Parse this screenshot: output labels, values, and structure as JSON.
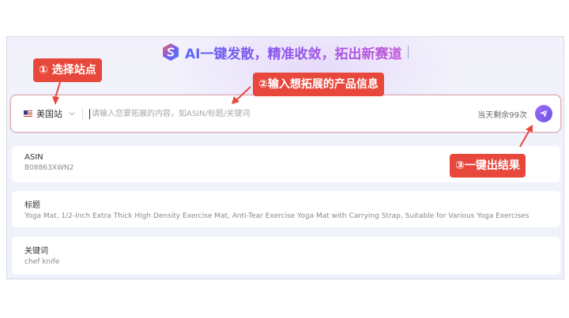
{
  "header": {
    "title": "AI一键发散，精准收敛，拓出新赛道",
    "logo_icon": "brand-s-logo-icon"
  },
  "search": {
    "site_label": "美国站",
    "site_flag_icon": "us-flag-icon",
    "placeholder": "请输入您要拓展的内容，如ASIN/标题/关键词",
    "remaining": "当天剩余99次",
    "submit_icon": "paper-plane-icon"
  },
  "examples": [
    {
      "label": "ASIN",
      "value": "B08863XWN2"
    },
    {
      "label": "标题",
      "value": "Yoga Mat, 1/2-Inch Extra Thick High Density Exercise Mat, Anti-Tear Exercise Yoga Mat with Carrying Strap, Suitable for Various Yoga Exercises"
    },
    {
      "label": "关键词",
      "value": "chef knife"
    }
  ],
  "callouts": [
    {
      "text": "① 选择站点"
    },
    {
      "text": "②输入想拓展的产品信息"
    },
    {
      "text": "③一键出结果"
    }
  ],
  "colors": {
    "accent": "#7b5cf0",
    "callout": "#e8473b",
    "border_highlight": "#e9b2a8"
  }
}
